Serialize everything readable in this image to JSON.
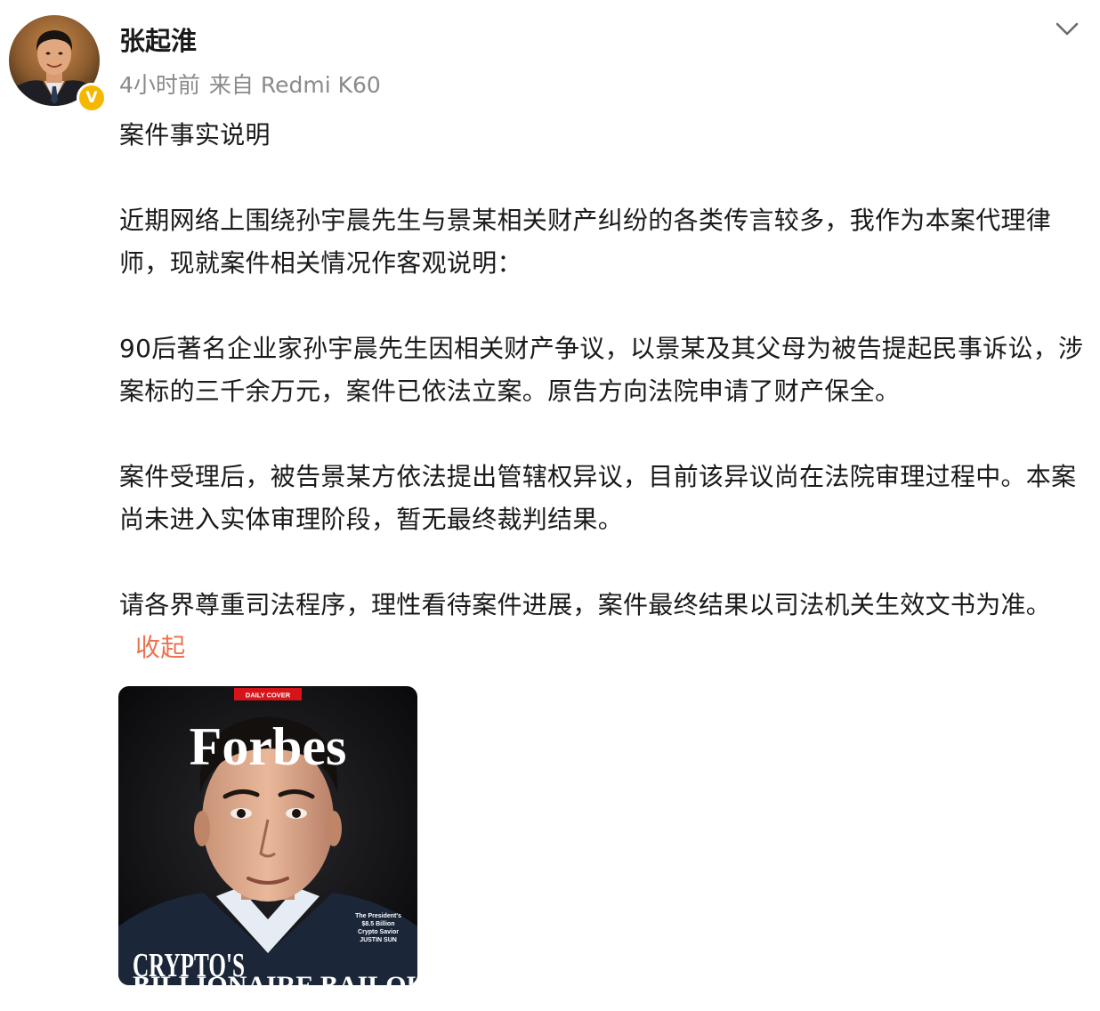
{
  "post": {
    "author": {
      "name": "张起淮",
      "verified_mark": "V"
    },
    "meta": {
      "time": "4小时前",
      "source": "来自 Redmi K60"
    },
    "paragraphs": [
      "案件事实说明",
      "近期网络上围绕孙宇晨先生与景某相关财产纠纷的各类传言较多，我作为本案代理律师，现就案件相关情况作客观说明：",
      "90后著名企业家孙宇晨先生因相关财产争议，以景某及其父母为被告提起民事诉讼，涉案标的三千余万元，案件已依法立案。原告方向法院申请了财产保全。",
      "案件受理后，被告景某方依法提出管辖权异议，目前该异议尚在法院审理过程中。本案尚未进入实体审理阶段，暂无最终裁判结果。",
      "请各界尊重司法程序，理性看待案件进展，案件最终结果以司法机关生效文书为准。"
    ],
    "collapse_label": "收起",
    "image": {
      "badge": "DAILY COVER",
      "masthead": "Forbes",
      "caption": [
        "The President's",
        "$8.5 Billion",
        "Crypto Savior",
        "JUSTIN SUN"
      ],
      "headline": "CRYPTO'S",
      "subheadline": "BILLIONAIRE BAILOUT"
    },
    "icons": {
      "menu": "chevron-down-icon"
    },
    "colors": {
      "link": "#eb7350",
      "meta": "#8a8a8a",
      "verified": "#f5b800",
      "cover_badge": "#d7141a"
    }
  }
}
